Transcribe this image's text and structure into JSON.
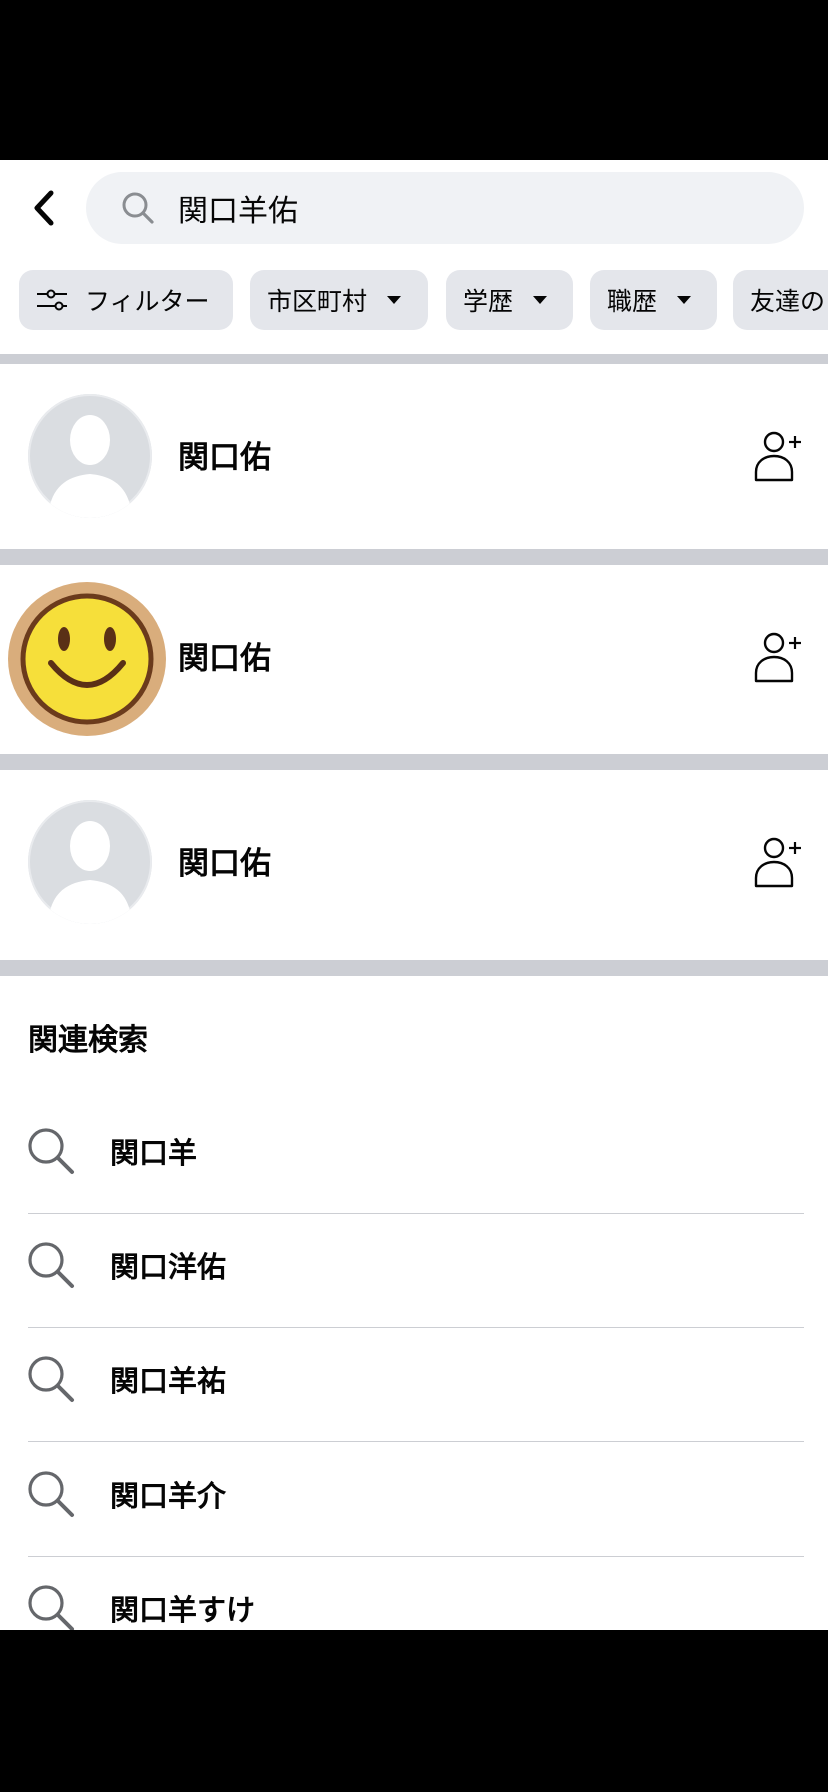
{
  "search": {
    "query": "関口羊佑"
  },
  "filters": [
    {
      "label": "フィルター"
    },
    {
      "label": "市区町村"
    },
    {
      "label": "学歴"
    },
    {
      "label": "職歴"
    },
    {
      "label": "友達の"
    }
  ],
  "results": [
    {
      "name": "関口佑",
      "avatar": "default-avatar"
    },
    {
      "name": "関口佑",
      "avatar": "smiley-avatar"
    },
    {
      "name": "関口佑",
      "avatar": "default-avatar"
    }
  ],
  "related": {
    "title": "関連検索",
    "items": [
      {
        "label": "関口羊"
      },
      {
        "label": "関口洋佑"
      },
      {
        "label": "関口羊祐"
      },
      {
        "label": "関口羊介"
      },
      {
        "label": "関口羊すけ"
      }
    ]
  },
  "colors": {
    "chip_bg": "#e4e6eb",
    "search_bg": "#f0f2f5",
    "separator": "#ccced4",
    "icon_gray": "#65676b"
  }
}
